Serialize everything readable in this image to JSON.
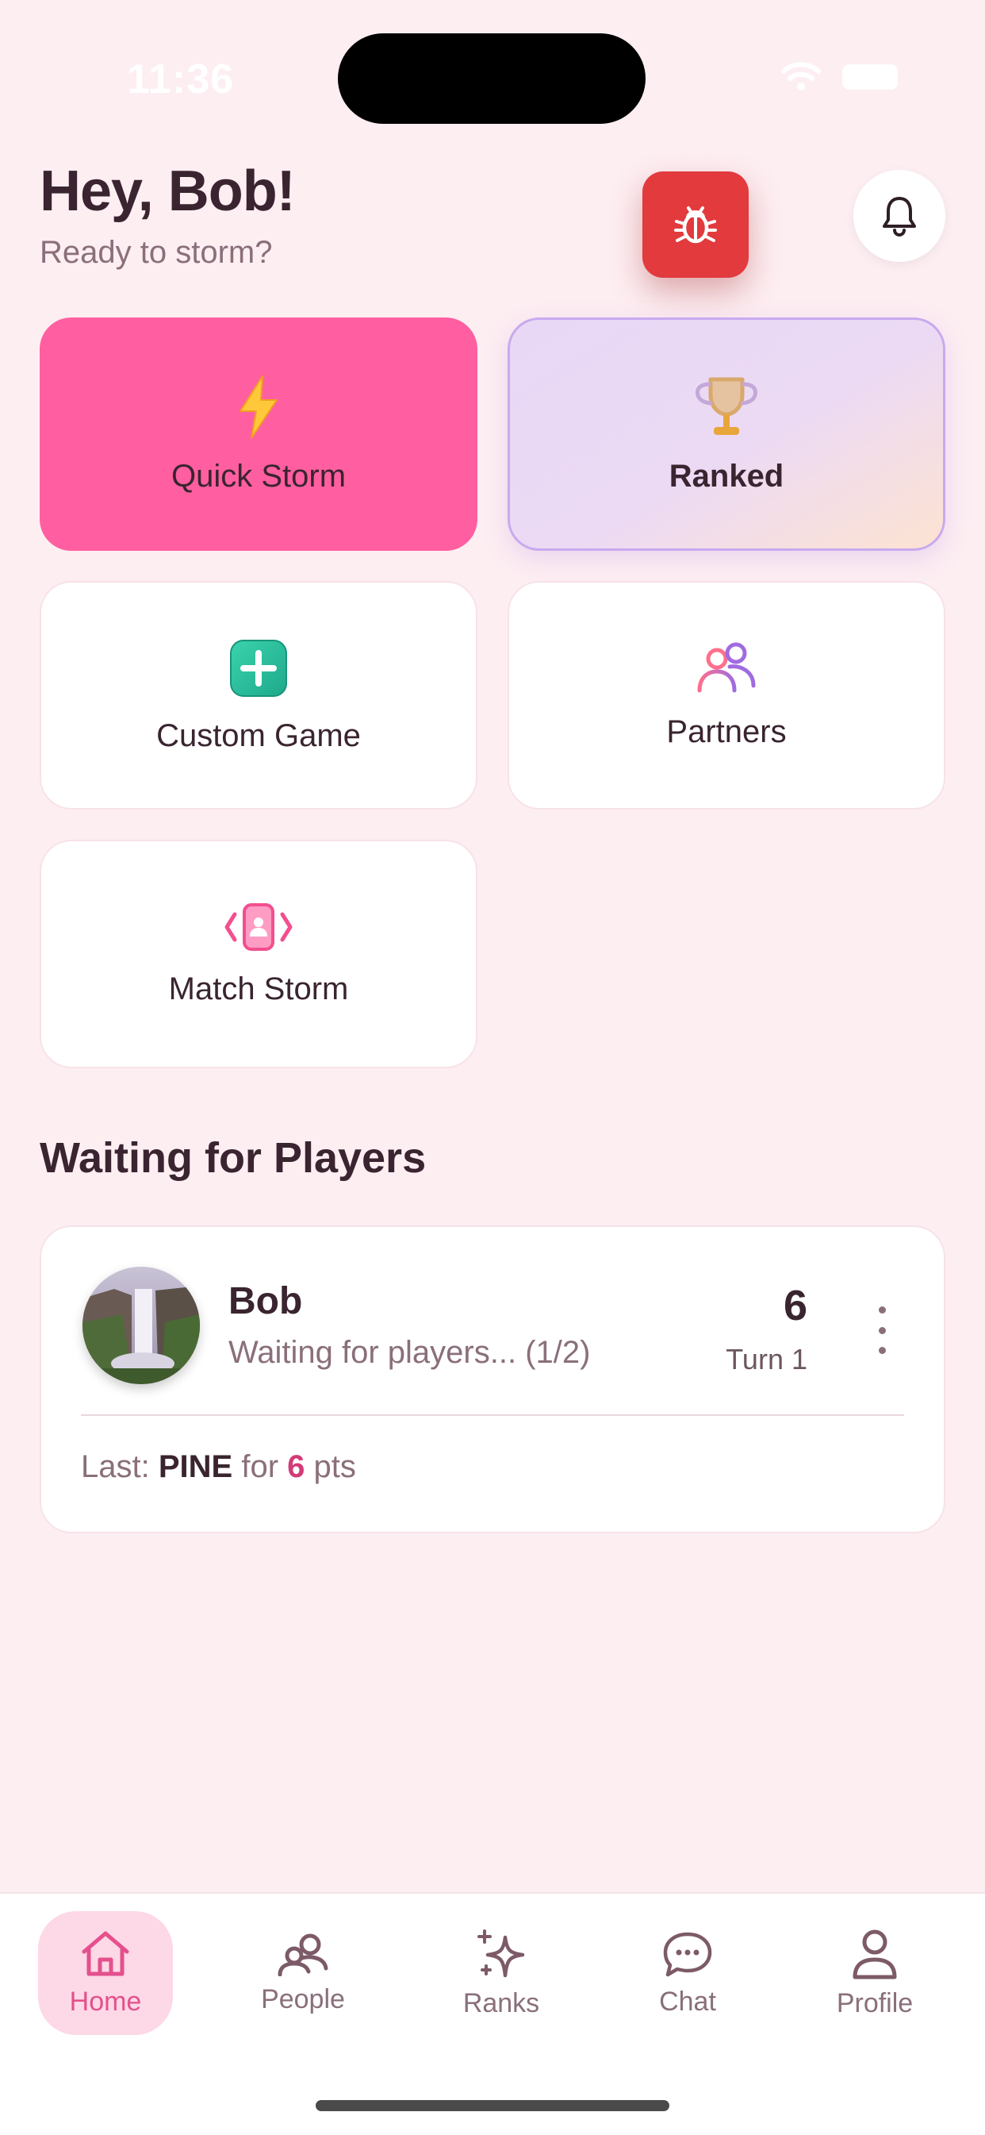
{
  "status_bar": {
    "time": "11:36"
  },
  "header": {
    "greeting": "Hey, Bob!",
    "subtitle": "Ready to storm?"
  },
  "modes": {
    "quick_storm": "Quick Storm",
    "ranked": "Ranked",
    "custom_game": "Custom Game",
    "partners": "Partners",
    "match_storm": "Match Storm"
  },
  "waiting_section": {
    "title": "Waiting for Players",
    "game": {
      "player": "Bob",
      "status": "Waiting for players... (1/2)",
      "score": "6",
      "turn": "Turn 1",
      "last_prefix": "Last:",
      "last_word": "PINE",
      "last_for": "for",
      "last_points": "6",
      "last_suffix": "pts"
    }
  },
  "nav": {
    "home": "Home",
    "people": "People",
    "ranks": "Ranks",
    "chat": "Chat",
    "profile": "Profile"
  },
  "colors": {
    "background": "#fdeef2",
    "accent_pink": "#ff5fa0",
    "bug_red": "#e23a3d",
    "points_pink": "#d43a78"
  }
}
